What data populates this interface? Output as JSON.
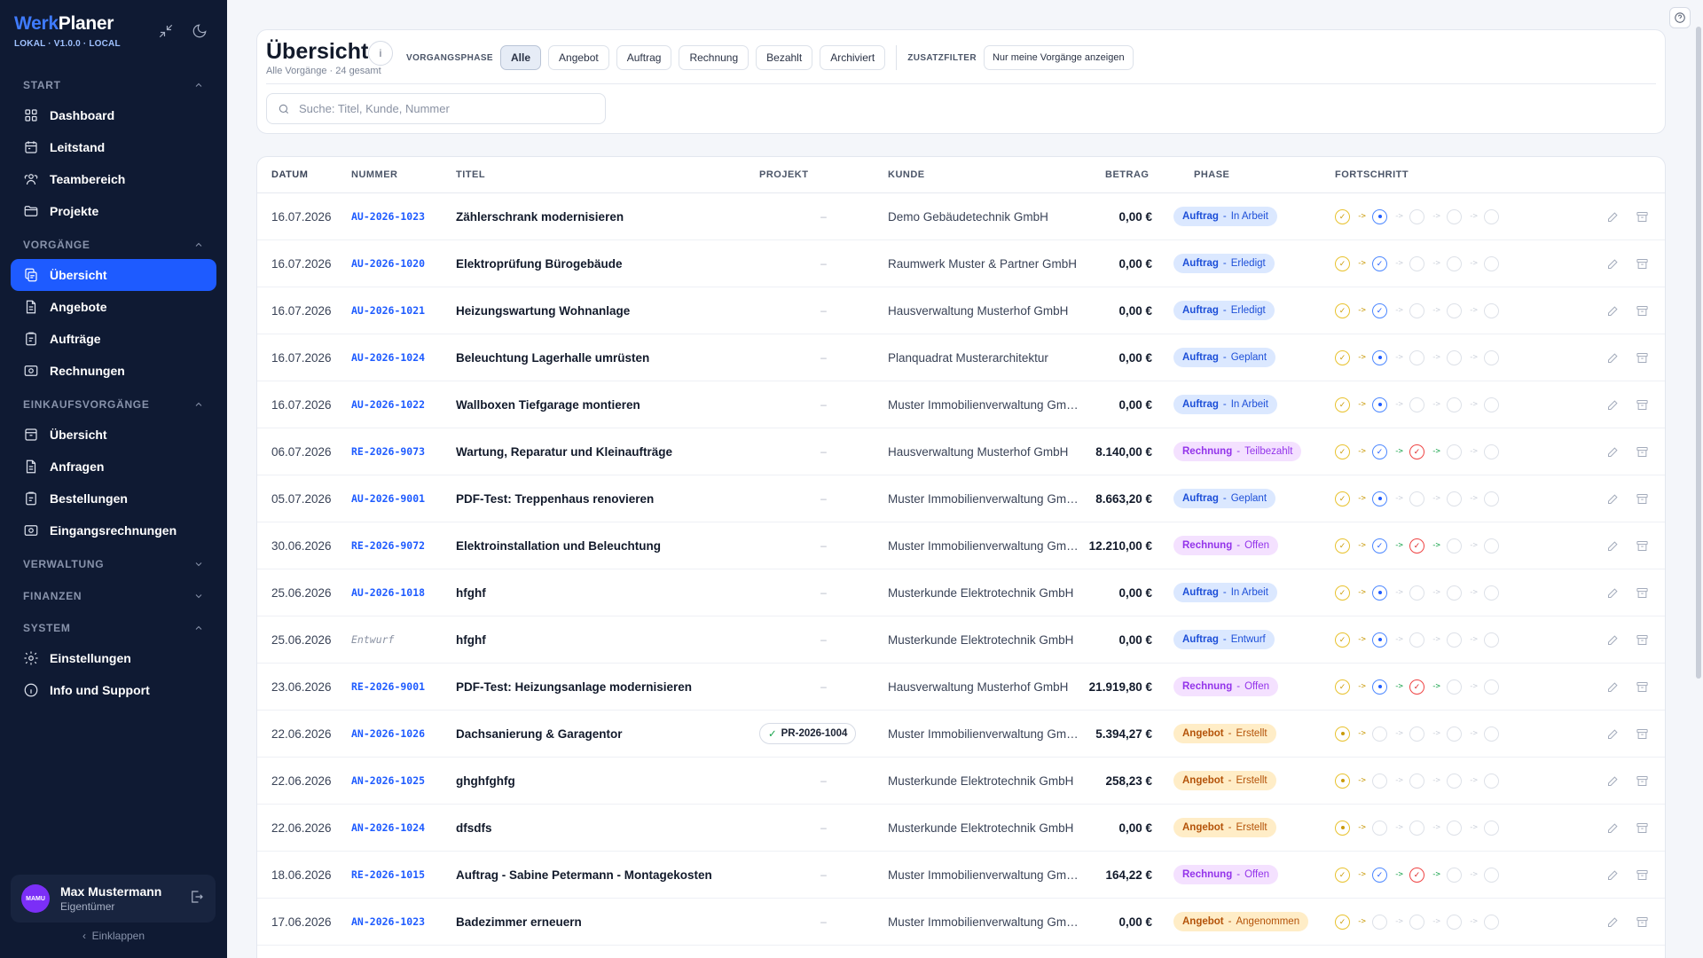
{
  "brand": {
    "werk": "Werk",
    "planer": "Planer",
    "version": "LOKAL · V1.0.0 · LOCAL"
  },
  "sidebar": {
    "sections": [
      {
        "label": "START",
        "expanded": true,
        "items": [
          {
            "label": "Dashboard",
            "icon": "grid-icon"
          },
          {
            "label": "Leitstand",
            "icon": "calendar-icon"
          },
          {
            "label": "Teambereich",
            "icon": "team-icon"
          },
          {
            "label": "Projekte",
            "icon": "folder-icon"
          }
        ]
      },
      {
        "label": "VORGÄNGE",
        "expanded": true,
        "items": [
          {
            "label": "Übersicht",
            "icon": "copy-icon",
            "active": true
          },
          {
            "label": "Angebote",
            "icon": "document-icon"
          },
          {
            "label": "Aufträge",
            "icon": "clipboard-icon"
          },
          {
            "label": "Rechnungen",
            "icon": "receipt-icon"
          }
        ]
      },
      {
        "label": "EINKAUFSVORGÄNGE",
        "expanded": true,
        "items": [
          {
            "label": "Übersicht",
            "icon": "archive-icon"
          },
          {
            "label": "Anfragen",
            "icon": "document-icon"
          },
          {
            "label": "Bestellungen",
            "icon": "clipboard-icon"
          },
          {
            "label": "Eingangsrechnungen",
            "icon": "receipt-icon"
          }
        ]
      },
      {
        "label": "VERWALTUNG",
        "expanded": false,
        "items": []
      },
      {
        "label": "FINANZEN",
        "expanded": false,
        "items": []
      },
      {
        "label": "SYSTEM",
        "expanded": true,
        "items": [
          {
            "label": "Einstellungen",
            "icon": "gear-icon"
          },
          {
            "label": "Info und Support",
            "icon": "info-icon"
          }
        ]
      }
    ]
  },
  "user": {
    "initials": "MAMU",
    "name": "Max Mustermann",
    "role": "Eigentümer"
  },
  "collapse_label": "Einklappen",
  "header": {
    "title": "Übersicht",
    "info": "i",
    "subtitle": "Alle Vorgänge · 24 gesamt",
    "phase_label": "VORGANGSPHASE",
    "phase_chips": [
      "Alle",
      "Angebot",
      "Auftrag",
      "Rechnung",
      "Bezahlt",
      "Archiviert"
    ],
    "extra_label": "ZUSATZFILTER",
    "extra_chip": "Nur meine Vorgänge anzeigen",
    "search_placeholder": "Suche: Titel, Kunde, Nummer"
  },
  "table": {
    "columns": {
      "datum": "DATUM",
      "nummer": "NUMMER",
      "titel": "TITEL",
      "projekt": "PROJEKT",
      "kunde": "KUNDE",
      "betrag": "BETRAG",
      "phase": "PHASE",
      "fortschritt": "FORTSCHRITT"
    },
    "empty_project": "–",
    "rows": [
      {
        "date": "16.07.2026",
        "number": "AU-2026-1023",
        "title": "Zählerschrank modernisieren",
        "project": "",
        "customer": "Demo Gebäudetechnik GmbH",
        "amount": "0,00 €",
        "phase": "Auftrag",
        "status": "In Arbeit",
        "progress": "1100"
      },
      {
        "date": "16.07.2026",
        "number": "AU-2026-1020",
        "title": "Elektroprüfung Bürogebäude",
        "project": "",
        "customer": "Raumwerk Muster & Partner GmbH",
        "amount": "0,00 €",
        "phase": "Auftrag",
        "status": "Erledigt",
        "progress": "1200"
      },
      {
        "date": "16.07.2026",
        "number": "AU-2026-1021",
        "title": "Heizungswartung Wohnanlage",
        "project": "",
        "customer": "Hausverwaltung Musterhof GmbH",
        "amount": "0,00 €",
        "phase": "Auftrag",
        "status": "Erledigt",
        "progress": "1200"
      },
      {
        "date": "16.07.2026",
        "number": "AU-2026-1024",
        "title": "Beleuchtung Lagerhalle umrüsten",
        "project": "",
        "customer": "Planquadrat Musterarchitektur",
        "amount": "0,00 €",
        "phase": "Auftrag",
        "status": "Geplant",
        "progress": "1100"
      },
      {
        "date": "16.07.2026",
        "number": "AU-2026-1022",
        "title": "Wallboxen Tiefgarage montieren",
        "project": "",
        "customer": "Muster Immobilienverwaltung GmbH",
        "amount": "0,00 €",
        "phase": "Auftrag",
        "status": "In Arbeit",
        "progress": "1100"
      },
      {
        "date": "06.07.2026",
        "number": "RE-2026-9073",
        "title": "Wartung, Reparatur und Kleinaufträge",
        "project": "",
        "customer": "Hausverwaltung Musterhof GmbH",
        "amount": "8.140,00 €",
        "phase": "Rechnung",
        "status": "Teilbezahlt",
        "progress": "1220"
      },
      {
        "date": "05.07.2026",
        "number": "AU-2026-9001",
        "title": "PDF-Test: Treppenhaus renovieren",
        "project": "",
        "customer": "Muster Immobilienverwaltung GmbH",
        "amount": "8.663,20 €",
        "phase": "Auftrag",
        "status": "Geplant",
        "progress": "1100"
      },
      {
        "date": "30.06.2026",
        "number": "RE-2026-9072",
        "title": "Elektroinstallation und Beleuchtung",
        "project": "",
        "customer": "Muster Immobilienverwaltung GmbH",
        "amount": "12.210,00 €",
        "phase": "Rechnung",
        "status": "Offen",
        "progress": "1220"
      },
      {
        "date": "25.06.2026",
        "number": "AU-2026-1018",
        "title": "hfghf",
        "project": "",
        "customer": "Musterkunde Elektrotechnik GmbH",
        "amount": "0,00 €",
        "phase": "Auftrag",
        "status": "In Arbeit",
        "progress": "1100"
      },
      {
        "date": "25.06.2026",
        "number": "Entwurf",
        "title": "hfghf",
        "project": "",
        "customer": "Musterkunde Elektrotechnik GmbH",
        "amount": "0,00 €",
        "phase": "Auftrag",
        "status": "Entwurf",
        "progress": "1100",
        "draft": true
      },
      {
        "date": "23.06.2026",
        "number": "RE-2026-9001",
        "title": "PDF-Test: Heizungsanlage modernisieren",
        "project": "",
        "customer": "Hausverwaltung Musterhof GmbH",
        "amount": "21.919,80 €",
        "phase": "Rechnung",
        "status": "Offen",
        "progress": "1120"
      },
      {
        "date": "22.06.2026",
        "number": "AN-2026-1026",
        "title": "Dachsanierung & Garagentor",
        "project": "PR-2026-1004",
        "customer": "Muster Immobilienverwaltung GmbH",
        "amount": "5.394,27 €",
        "phase": "Angebot",
        "status": "Erstellt",
        "progress": "1000"
      },
      {
        "date": "22.06.2026",
        "number": "AN-2026-1025",
        "title": "ghghfghfg",
        "project": "",
        "customer": "Musterkunde Elektrotechnik GmbH",
        "amount": "258,23 €",
        "phase": "Angebot",
        "status": "Erstellt",
        "progress": "1000"
      },
      {
        "date": "22.06.2026",
        "number": "AN-2026-1024",
        "title": "dfsdfs",
        "project": "",
        "customer": "Musterkunde Elektrotechnik GmbH",
        "amount": "0,00 €",
        "phase": "Angebot",
        "status": "Erstellt",
        "progress": "1000"
      },
      {
        "date": "18.06.2026",
        "number": "RE-2026-1015",
        "title": "Auftrag - Sabine Petermann - Montagekosten",
        "project": "",
        "customer": "Muster Immobilienverwaltung GmbH",
        "amount": "164,22 €",
        "phase": "Rechnung",
        "status": "Offen",
        "progress": "1220"
      },
      {
        "date": "17.06.2026",
        "number": "AN-2026-1023",
        "title": "Badezimmer erneuern",
        "project": "",
        "customer": "Muster Immobilienverwaltung GmbH",
        "amount": "0,00 €",
        "phase": "Angebot",
        "status": "Angenommen",
        "progress": "2000"
      }
    ]
  }
}
